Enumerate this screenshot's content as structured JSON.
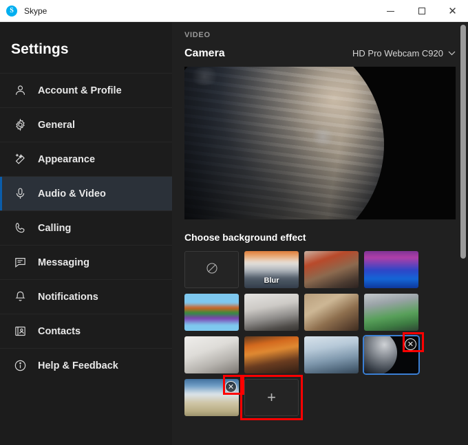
{
  "window": {
    "app_name": "Skype",
    "logo_letter": "S",
    "controls": {
      "minimize": "Minimize",
      "maximize": "Maximize",
      "close": "Close"
    }
  },
  "sidebar": {
    "title": "Settings",
    "items": [
      {
        "label": "Account & Profile",
        "icon": "person-icon",
        "active": false
      },
      {
        "label": "General",
        "icon": "gear-icon",
        "active": false
      },
      {
        "label": "Appearance",
        "icon": "wand-icon",
        "active": false
      },
      {
        "label": "Audio & Video",
        "icon": "microphone-icon",
        "active": true
      },
      {
        "label": "Calling",
        "icon": "phone-icon",
        "active": false
      },
      {
        "label": "Messaging",
        "icon": "chat-icon",
        "active": false
      },
      {
        "label": "Notifications",
        "icon": "bell-icon",
        "active": false
      },
      {
        "label": "Contacts",
        "icon": "contact-card-icon",
        "active": false
      },
      {
        "label": "Help & Feedback",
        "icon": "info-icon",
        "active": false
      }
    ]
  },
  "content": {
    "section_label": "VIDEO",
    "camera_label": "Camera",
    "camera_value": "HD Pro Webcam C920",
    "chevron": "⌄",
    "background_title": "Choose background effect",
    "none_icon": "no-effect-icon",
    "blur_label": "Blur",
    "add_label": "+",
    "remove_icon": "✕",
    "tiles": [
      {
        "name": "none",
        "art": "none",
        "label": "",
        "selected": false,
        "removable": false
      },
      {
        "name": "blur",
        "art": "t-blur",
        "label": "Blur",
        "selected": false,
        "removable": false
      },
      {
        "name": "street",
        "art": "t-street",
        "label": "",
        "selected": false,
        "removable": false
      },
      {
        "name": "neon",
        "art": "t-neon",
        "label": "",
        "selected": false,
        "removable": false
      },
      {
        "name": "abstract",
        "art": "t-abstract",
        "label": "",
        "selected": false,
        "removable": false
      },
      {
        "name": "office",
        "art": "t-office",
        "label": "",
        "selected": false,
        "removable": false
      },
      {
        "name": "climbing",
        "art": "t-climb",
        "label": "",
        "selected": false,
        "removable": false
      },
      {
        "name": "gym",
        "art": "t-gym",
        "label": "",
        "selected": false,
        "removable": false
      },
      {
        "name": "room",
        "art": "t-room",
        "label": "",
        "selected": false,
        "removable": false
      },
      {
        "name": "autumn",
        "art": "t-autumn",
        "label": "",
        "selected": false,
        "removable": false
      },
      {
        "name": "blue-room",
        "art": "t-blueroom",
        "label": "",
        "selected": false,
        "removable": false
      },
      {
        "name": "planet",
        "art": "t-planet",
        "label": "",
        "selected": true,
        "removable": true
      },
      {
        "name": "beach",
        "art": "t-beach",
        "label": "",
        "selected": false,
        "removable": true
      },
      {
        "name": "add",
        "art": "add",
        "label": "+",
        "selected": false,
        "removable": false
      }
    ]
  },
  "colors": {
    "accent": "#0b5dab",
    "selection_border": "#3a7fd5",
    "highlight_box": "#ff0000",
    "sidebar_bg": "#1c1c1c",
    "content_bg": "#202020",
    "active_item_bg": "#2b3139"
  }
}
